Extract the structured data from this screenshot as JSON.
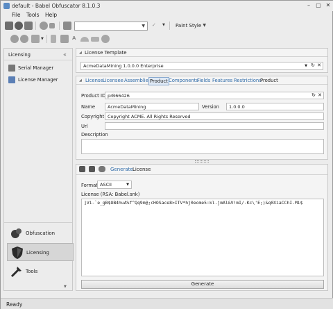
{
  "window": {
    "title": "default - Babel Obfuscator 8.1.0.3"
  },
  "menu": {
    "file": "File",
    "tools": "Tools",
    "help": "Help"
  },
  "toolbar": {
    "paint_style": "Paint Style"
  },
  "sidebar": {
    "header": "Licensing",
    "items": [
      {
        "label": "Serial Manager"
      },
      {
        "label": "License Manager"
      }
    ],
    "nav": [
      {
        "label": "Obfuscation"
      },
      {
        "label": "Licensing"
      },
      {
        "label": "Tools"
      }
    ]
  },
  "license_template": {
    "title": "License Template",
    "selected": "AcmeDataMining 1.0.0.0 Enterprise"
  },
  "product_tabs": [
    "License",
    "Licensee",
    "Assemblies",
    "Product",
    "Components",
    "Fields",
    "Features",
    "Restrictions",
    "Product"
  ],
  "product": {
    "id_label": "Product ID",
    "id_value": "prB66426",
    "name_label": "Name",
    "name_value": "AcmeDataMining",
    "version_label": "Version",
    "version_value": "1.0.0.0",
    "copyright_label": "Copyright",
    "copyright_value": "Copyright ACME. All Rights Reserved",
    "url_label": "Url",
    "url_value": "",
    "description_label": "Description",
    "description_value": ""
  },
  "generate_panel": {
    "generate_link": "Generate",
    "license_title": "License",
    "format_label": "Format",
    "format_value": "ASCII",
    "license_label": "License (RSA: Babel.snk)",
    "license_text": "]Vi-`e_gB$OB4huA%f^Qq9m@;cHOSace8>ITV*hj0eome5:kl.jmAl&V!mI/-Kc\\'E;)&q0XiaCChI.Mi$",
    "generate_button": "Generate"
  },
  "status": {
    "text": "Ready"
  }
}
